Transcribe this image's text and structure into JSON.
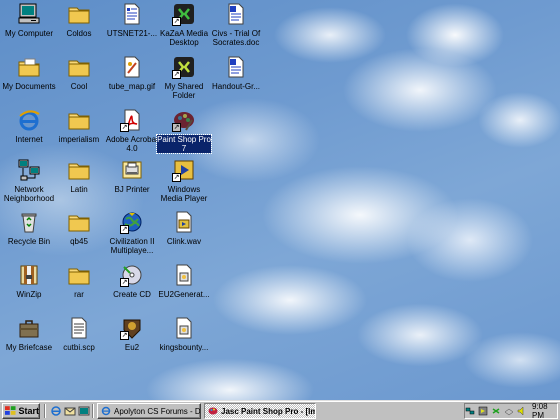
{
  "desktop": {
    "icons": [
      {
        "label": "My Computer",
        "icon": "my-computer-icon",
        "shortcut": false
      },
      {
        "label": "Coldos",
        "icon": "folder-icon",
        "shortcut": false
      },
      {
        "label": "UTSNET21-...",
        "icon": "document-icon",
        "shortcut": false
      },
      {
        "label": "KaZaA Media\nDesktop",
        "icon": "kazaa-icon",
        "shortcut": true
      },
      {
        "label": "Civs - Trial Of\nSocrates.doc",
        "icon": "word-doc-icon",
        "shortcut": false
      },
      {
        "label": "My Documents",
        "icon": "my-documents-icon",
        "shortcut": false
      },
      {
        "label": "Cool",
        "icon": "folder-icon",
        "shortcut": false
      },
      {
        "label": "tube_map.gif",
        "icon": "gif-image-icon",
        "shortcut": false
      },
      {
        "label": "My Shared\nFolder",
        "icon": "shared-folder-icon",
        "shortcut": true
      },
      {
        "label": "Handout-Gr...",
        "icon": "word-doc-icon",
        "shortcut": false
      },
      {
        "label": "Internet",
        "icon": "internet-explorer-icon",
        "shortcut": false
      },
      {
        "label": "imperialism",
        "icon": "folder-icon",
        "shortcut": false
      },
      {
        "label": "Adobe Acrobat\n4.0",
        "icon": "acrobat-icon",
        "shortcut": true
      },
      {
        "label": "Paint Shop Pro\n7",
        "icon": "paint-shop-pro-icon",
        "shortcut": true,
        "selected": true
      },
      {
        "label": "Network\nNeighborhood",
        "icon": "network-icon",
        "shortcut": false
      },
      {
        "label": "Latin",
        "icon": "folder-icon",
        "shortcut": false
      },
      {
        "label": "BJ Printer",
        "icon": "printer-icon",
        "shortcut": false
      },
      {
        "label": "Windows\nMedia Player",
        "icon": "media-player-icon",
        "shortcut": true
      },
      {
        "label": "Recycle Bin",
        "icon": "recycle-bin-icon",
        "shortcut": false
      },
      {
        "label": "qb45",
        "icon": "folder-icon",
        "shortcut": false
      },
      {
        "label": "Civilization II\nMultiplaye...",
        "icon": "civilization-icon",
        "shortcut": true
      },
      {
        "label": "Clink.wav",
        "icon": "sound-file-icon",
        "shortcut": false
      },
      {
        "label": "WinZip",
        "icon": "winzip-icon",
        "shortcut": false
      },
      {
        "label": "rar",
        "icon": "folder-icon",
        "shortcut": false
      },
      {
        "label": "Create CD",
        "icon": "create-cd-icon",
        "shortcut": true
      },
      {
        "label": "EU2Generat...",
        "icon": "document-icon",
        "shortcut": false
      },
      {
        "label": "My Briefcase",
        "icon": "briefcase-icon",
        "shortcut": false
      },
      {
        "label": "cutbi.scp",
        "icon": "text-file-icon",
        "shortcut": false
      },
      {
        "label": "Eu2",
        "icon": "eu2-icon",
        "shortcut": true
      },
      {
        "label": "kingsbounty...",
        "icon": "document-icon",
        "shortcut": false
      }
    ]
  },
  "taskbar": {
    "start_label": "Start",
    "tasks": [
      {
        "label": "Apolyton CS Forums - Des...",
        "active": false
      },
      {
        "label": "Jasc Paint Shop Pro - [Ima...",
        "active": true
      }
    ],
    "clock": "9:08 PM"
  }
}
